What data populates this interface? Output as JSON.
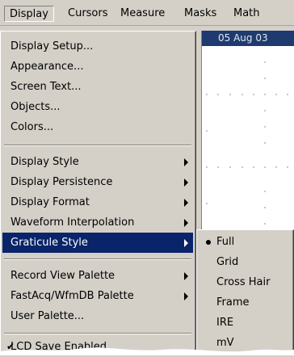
{
  "menubar": {
    "items": [
      {
        "label": "Display"
      },
      {
        "label": "Cursors"
      },
      {
        "label": "Measure"
      },
      {
        "label": "Masks"
      },
      {
        "label": "Math"
      }
    ]
  },
  "scope": {
    "header_date": "05 Aug 03"
  },
  "display_menu": {
    "items": [
      {
        "label": "Display Setup..."
      },
      {
        "label": "Appearance..."
      },
      {
        "label": "Screen Text..."
      },
      {
        "label": "Objects..."
      },
      {
        "label": "Colors..."
      },
      {
        "label": "Display Style"
      },
      {
        "label": "Display Persistence"
      },
      {
        "label": "Display Format"
      },
      {
        "label": "Waveform Interpolation"
      },
      {
        "label": "Graticule Style"
      },
      {
        "label": "Record View Palette"
      },
      {
        "label": "FastAcq/WfmDB Palette"
      },
      {
        "label": "User Palette..."
      },
      {
        "label": "LCD Save Enabled"
      }
    ],
    "checked_item": "LCD Save Enabled",
    "highlighted_item": "Graticule Style"
  },
  "graticule_submenu": {
    "items": [
      {
        "label": "Full"
      },
      {
        "label": "Grid"
      },
      {
        "label": "Cross Hair"
      },
      {
        "label": "Frame"
      },
      {
        "label": "IRE"
      },
      {
        "label": "mV"
      }
    ],
    "selected_item": "Full"
  },
  "colors": {
    "menu_bg": "#d4d0c8",
    "highlight": "#0a246a",
    "scope_header": "#1e3a6e"
  }
}
